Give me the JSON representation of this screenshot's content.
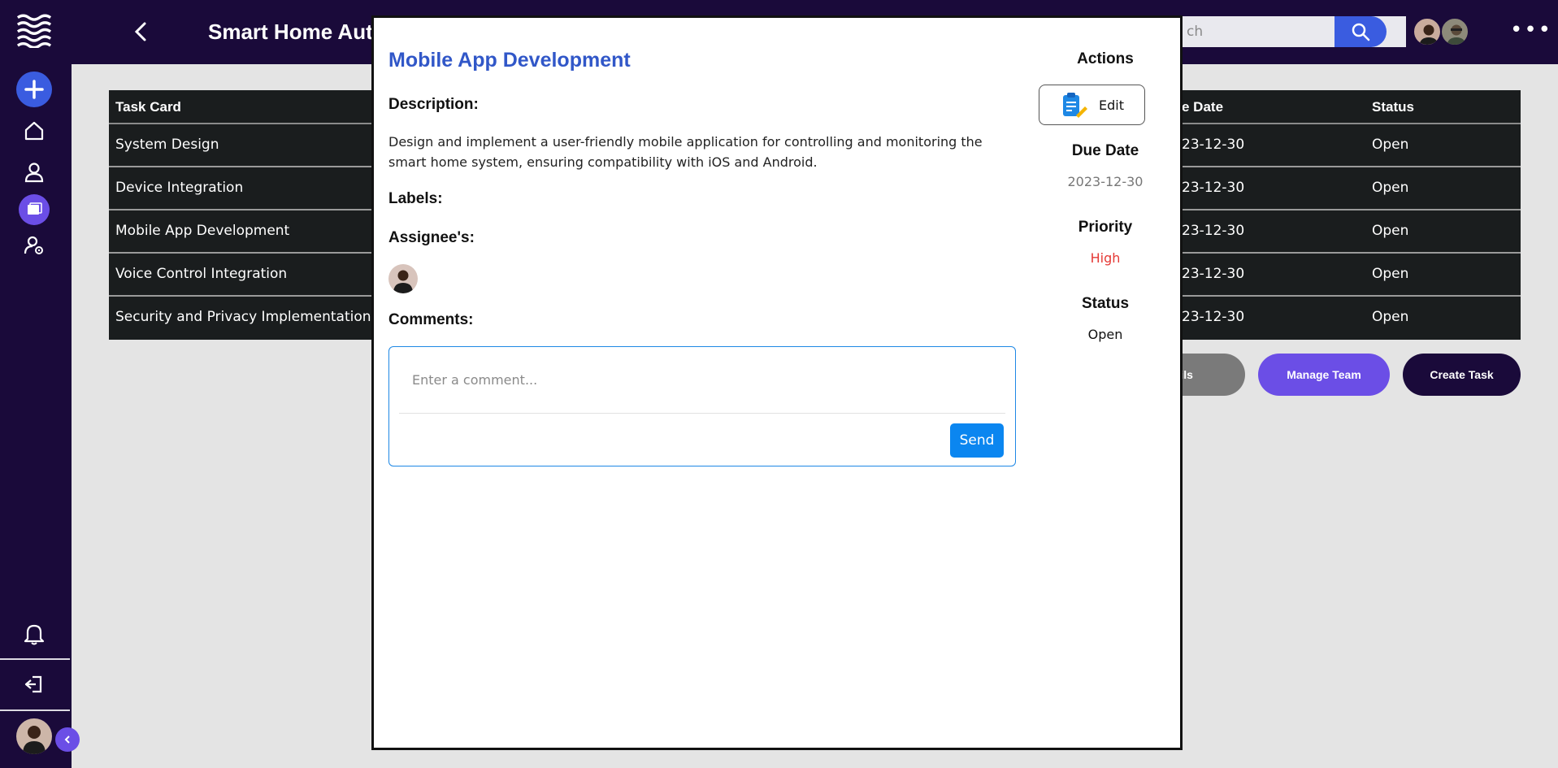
{
  "app": {
    "title": "Smart Home Aut",
    "search_placeholder": "ch"
  },
  "sidebar": {
    "items": [
      "add",
      "home",
      "user",
      "projects",
      "user-settings",
      "notifications",
      "logout"
    ]
  },
  "table": {
    "headers": [
      "Task Card",
      "e Date",
      "Status"
    ],
    "rows": [
      {
        "task": "System Design",
        "due": "23-12-30",
        "status": "Open"
      },
      {
        "task": "Device Integration",
        "due": "23-12-30",
        "status": "Open"
      },
      {
        "task": "Mobile App Development",
        "due": "23-12-30",
        "status": "Open"
      },
      {
        "task": "Voice Control Integration",
        "due": "23-12-30",
        "status": "Open"
      },
      {
        "task": "Security and Privacy Implementation",
        "due": "23-12-30",
        "status": "Open"
      }
    ]
  },
  "buttons": {
    "details": "Details",
    "manage_team": "Manage Team",
    "create_task": "Create Task"
  },
  "modal": {
    "title": "Mobile App Development",
    "description_label": "Description:",
    "description": "Design and implement a user-friendly mobile application for controlling and monitoring the smart home system, ensuring compatibility with iOS and Android.",
    "labels_label": "Labels:",
    "assignees_label": "Assignee's:",
    "comments_label": "Comments:",
    "comment_placeholder": "Enter a comment...",
    "send_label": "Send",
    "actions_label": "Actions",
    "edit_label": "Edit",
    "due_date_label": "Due Date",
    "due_date": "2023-12-30",
    "priority_label": "Priority",
    "priority": "High",
    "status_label": "Status",
    "status": "Open"
  },
  "colors": {
    "nav_bg": "#1a0a3a",
    "accent": "#3a5ce0",
    "title_blue": "#3157c8",
    "priority_high": "#e53935",
    "manage_team": "#6b4ee6",
    "send": "#0b86f0"
  }
}
